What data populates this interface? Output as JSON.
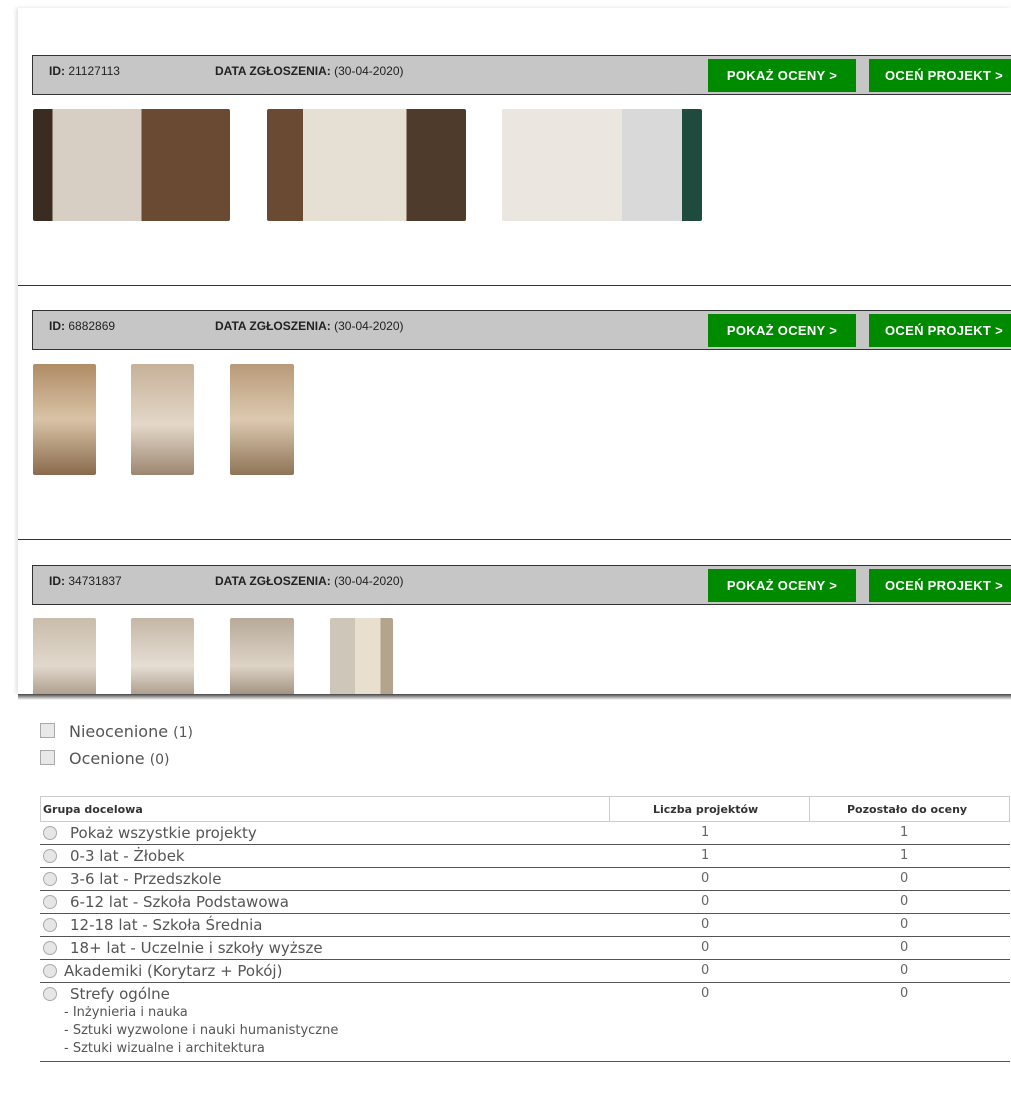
{
  "projects": [
    {
      "id_label": "ID:",
      "id_value": "21127113",
      "date_label": "DATA ZGŁOSZENIA:",
      "date_value": "(30-04-2020)"
    },
    {
      "id_label": "ID:",
      "id_value": "6882869",
      "date_label": "DATA ZGŁOSZENIA:",
      "date_value": "(30-04-2020)"
    },
    {
      "id_label": "ID:",
      "id_value": "34731837",
      "date_label": "DATA ZGŁOSZENIA:",
      "date_value": "(30-04-2020)"
    }
  ],
  "buttons": {
    "show_ratings": "POKAŻ OCENY >",
    "rate_project": "OCEŃ PROJEKT >"
  },
  "filters": [
    {
      "label": "Nieocenione",
      "count": "(1)"
    },
    {
      "label": "Ocenione",
      "count": "(0)"
    }
  ],
  "table": {
    "headers": [
      "Grupa docelowa",
      "Liczba projektów",
      "Pozostało do oceny"
    ],
    "rows": [
      {
        "label": "Pokaż wszystkie projekty",
        "projects": "1",
        "remaining": "1"
      },
      {
        "label": "0-3 lat - Żłobek",
        "projects": "1",
        "remaining": "1"
      },
      {
        "label": "3-6 lat - Przedszkole",
        "projects": "0",
        "remaining": "0"
      },
      {
        "label": "6-12 lat - Szkoła Podstawowa",
        "projects": "0",
        "remaining": "0"
      },
      {
        "label": "12-18 lat - Szkoła Średnia",
        "projects": "0",
        "remaining": "0"
      },
      {
        "label": "18+ lat - Uczelnie i szkoły wyższe",
        "projects": "0",
        "remaining": "0"
      },
      {
        "label": "Akademiki (Korytarz + Pokój)",
        "projects": "0",
        "remaining": "0"
      },
      {
        "label": "Strefy ogólne",
        "projects": "0",
        "remaining": "0",
        "sub": [
          "- Inżynieria i nauka",
          "- Sztuki wyzwolone i nauki humanistyczne",
          "- Sztuki wizualne i architektura"
        ]
      }
    ]
  },
  "colors": {
    "button_green": "#008a00",
    "bar_gray": "#c6c6c6"
  }
}
